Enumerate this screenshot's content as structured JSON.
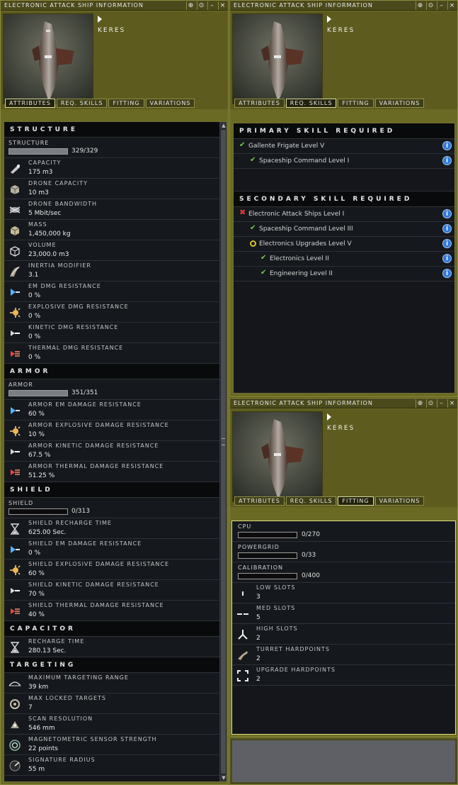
{
  "ship_name": "KERES",
  "window_title": "ELECTRONIC ATTACK SHIP INFORMATION",
  "tabs": [
    "ATTRIBUTES",
    "REQ. SKILLS",
    "FITTING",
    "VARIATIONS"
  ],
  "window_buttons": [
    "pin-icon",
    "settings-icon",
    "minimize-icon",
    "close-icon"
  ],
  "attributes": {
    "structure": {
      "header": "STRUCTURE",
      "bar": {
        "label": "STRUCTURE",
        "value": "329/329",
        "fill_pct": 100
      },
      "rows": [
        {
          "icon": "capacity-icon",
          "label": "CAPACITY",
          "value": "175 m3"
        },
        {
          "icon": "drone-capacity-icon",
          "label": "DRONE CAPACITY",
          "value": "10 m3"
        },
        {
          "icon": "drone-bandwidth-icon",
          "label": "DRONE BANDWIDTH",
          "value": "5 Mbit/sec"
        },
        {
          "icon": "mass-icon",
          "label": "MASS",
          "value": "1,450,000 kg"
        },
        {
          "icon": "volume-icon",
          "label": "VOLUME",
          "value": "23,000.0 m3"
        },
        {
          "icon": "inertia-icon",
          "label": "INERTIA MODIFIER",
          "value": "3.1"
        },
        {
          "icon": "em-resist-icon",
          "label": "EM DMG RESISTANCE",
          "value": "0 %"
        },
        {
          "icon": "explosive-resist-icon",
          "label": "EXPLOSIVE DMG RESISTANCE",
          "value": "0 %"
        },
        {
          "icon": "kinetic-resist-icon",
          "label": "KINETIC DMG RESISTANCE",
          "value": "0 %"
        },
        {
          "icon": "thermal-resist-icon",
          "label": "THERMAL DMG RESISTANCE",
          "value": "0 %"
        }
      ]
    },
    "armor": {
      "header": "ARMOR",
      "bar": {
        "label": "ARMOR",
        "value": "351/351",
        "fill_pct": 100
      },
      "rows": [
        {
          "icon": "em-resist-icon",
          "label": "ARMOR EM DAMAGE RESISTANCE",
          "value": "60 %"
        },
        {
          "icon": "explosive-resist-icon",
          "label": "ARMOR EXPLOSIVE DAMAGE RESISTANCE",
          "value": "10 %"
        },
        {
          "icon": "kinetic-resist-icon",
          "label": "ARMOR KINETIC DAMAGE RESISTANCE",
          "value": "67.5 %"
        },
        {
          "icon": "thermal-resist-icon",
          "label": "ARMOR THERMAL DAMAGE RESISTANCE",
          "value": "51.25 %"
        }
      ]
    },
    "shield": {
      "header": "SHIELD",
      "bar": {
        "label": "SHIELD",
        "value": "0/313",
        "fill_pct": 0
      },
      "rows": [
        {
          "icon": "hourglass-icon",
          "label": "SHIELD RECHARGE TIME",
          "value": "625.00 Sec."
        },
        {
          "icon": "em-resist-icon",
          "label": "SHIELD EM DAMAGE RESISTANCE",
          "value": "0 %"
        },
        {
          "icon": "explosive-resist-icon",
          "label": "SHIELD EXPLOSIVE DAMAGE RESISTANCE",
          "value": "60 %"
        },
        {
          "icon": "kinetic-resist-icon",
          "label": "SHIELD KINETIC DAMAGE RESISTANCE",
          "value": "70 %"
        },
        {
          "icon": "thermal-resist-icon",
          "label": "SHIELD THERMAL DAMAGE RESISTANCE",
          "value": "40 %"
        }
      ]
    },
    "capacitor": {
      "header": "CAPACITOR",
      "rows": [
        {
          "icon": "hourglass-icon",
          "label": "RECHARGE TIME",
          "value": "280.13 Sec."
        }
      ]
    },
    "targeting": {
      "header": "TARGETING",
      "rows": [
        {
          "icon": "targeting-range-icon",
          "label": "MAXIMUM TARGETING RANGE",
          "value": "39 km"
        },
        {
          "icon": "locked-targets-icon",
          "label": "MAX LOCKED TARGETS",
          "value": "7"
        },
        {
          "icon": "scan-resolution-icon",
          "label": "SCAN RESOLUTION",
          "value": "546 mm"
        },
        {
          "icon": "sensor-strength-icon",
          "label": "MAGNETOMETRIC SENSOR STRENGTH",
          "value": "22 points"
        },
        {
          "icon": "signature-radius-icon",
          "label": "SIGNATURE RADIUS",
          "value": "55 m"
        }
      ]
    }
  },
  "req_skills": {
    "primary_header": "PRIMARY SKILL REQUIRED",
    "primary": [
      {
        "status": "ok",
        "indent": 0,
        "name": "Gallente Frigate Level V"
      },
      {
        "status": "ok",
        "indent": 1,
        "name": "Spaceship Command Level I"
      }
    ],
    "secondary_header": "SECONDARY SKILL REQUIRED",
    "secondary": [
      {
        "status": "missing",
        "indent": 0,
        "name": "Electronic Attack Ships Level I"
      },
      {
        "status": "ok",
        "indent": 1,
        "name": "Spaceship Command Level III"
      },
      {
        "status": "partial",
        "indent": 1,
        "name": "Electronics Upgrades Level V"
      },
      {
        "status": "ok",
        "indent": 2,
        "name": "Electronics Level II"
      },
      {
        "status": "ok",
        "indent": 2,
        "name": "Engineering Level II"
      }
    ]
  },
  "fitting": {
    "bars": [
      {
        "label": "CPU",
        "value": "0/270",
        "fill_pct": 0
      },
      {
        "label": "POWERGRID",
        "value": "0/33",
        "fill_pct": 0
      },
      {
        "label": "CALIBRATION",
        "value": "0/400",
        "fill_pct": 0
      }
    ],
    "rows": [
      {
        "icon": "low-slot-icon",
        "label": "LOW SLOTS",
        "value": "3"
      },
      {
        "icon": "med-slot-icon",
        "label": "MED SLOTS",
        "value": "5"
      },
      {
        "icon": "high-slot-icon",
        "label": "HIGH SLOTS",
        "value": "2"
      },
      {
        "icon": "turret-hardpoint-icon",
        "label": "TURRET HARDPOINTS",
        "value": "2"
      },
      {
        "icon": "upgrade-hardpoint-icon",
        "label": "UPGRADE HARDPOINTS",
        "value": "2"
      }
    ]
  }
}
